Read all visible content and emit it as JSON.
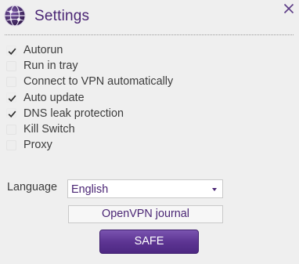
{
  "header": {
    "title": "Settings",
    "logo_icon": "globe-logo-icon",
    "close_icon": "close-icon",
    "accent_color": "#4a2574"
  },
  "options": [
    {
      "label": "Autorun",
      "checked": true
    },
    {
      "label": "Run in tray",
      "checked": false
    },
    {
      "label": "Connect to VPN automatically",
      "checked": false
    },
    {
      "label": "Auto update",
      "checked": true
    },
    {
      "label": "DNS leak protection",
      "checked": true
    },
    {
      "label": "Kill Switch",
      "checked": false
    },
    {
      "label": "Proxy",
      "checked": false
    }
  ],
  "language": {
    "label": "Language",
    "selected": "English"
  },
  "buttons": {
    "journal": "OpenVPN journal",
    "save": "SAFE"
  }
}
